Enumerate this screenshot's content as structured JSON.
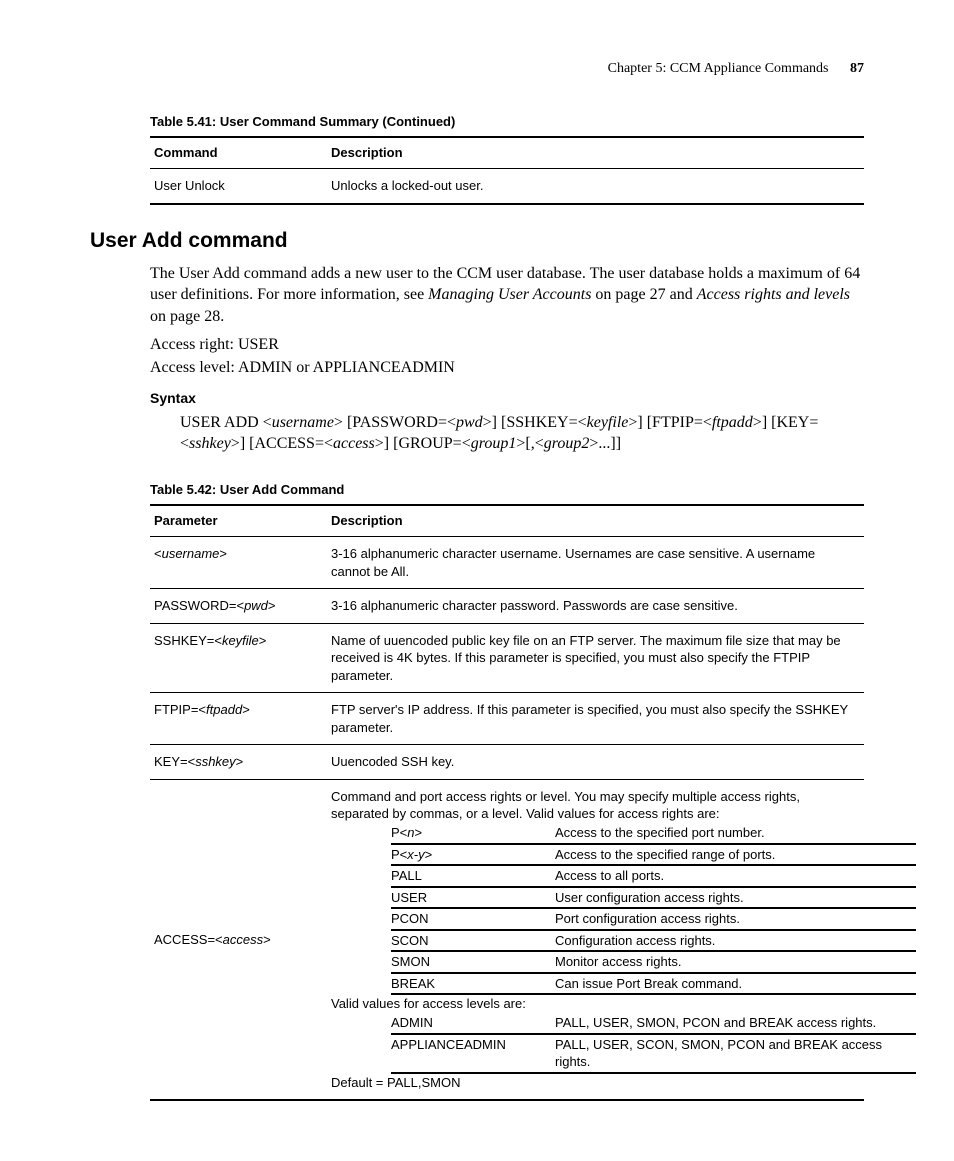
{
  "header": {
    "chapter": "Chapter 5: CCM Appliance Commands",
    "page": "87"
  },
  "table41": {
    "caption": "Table 5.41: User Command Summary (Continued)",
    "head": {
      "c1": "Command",
      "c2": "Description"
    },
    "rows": [
      {
        "c1": "User Unlock",
        "c2": "Unlocks a locked-out user."
      }
    ]
  },
  "section": {
    "heading": "User Add command",
    "p1a": "The User Add command adds a new user to the CCM user database. The user database holds a maximum of 64 user definitions. For more information, see ",
    "p1b": "Managing User Accounts",
    "p1c": " on page 27 and ",
    "p1d": "Access rights and levels",
    "p1e": " on page 28.",
    "access_right": "Access right: USER",
    "access_level": "Access level: ADMIN or APPLIANCEADMIN",
    "syntax_label": "Syntax",
    "syntax": {
      "s1": "USER ADD <",
      "s1i": "username",
      "s2": "> [PASSWORD=<",
      "s2i": "pwd",
      "s3": ">] [SSHKEY=<",
      "s3i": "keyfile",
      "s4": ">] [FTPIP=<",
      "s4i": "ftpadd",
      "s5": ">] [KEY=<",
      "s5i": "sshkey",
      "s6": ">] [ACCESS=<",
      "s6i": "access",
      "s7": ">] [GROUP=<",
      "s7i": "group1",
      "s8": ">[,<",
      "s8i": "group2",
      "s9": ">...]]"
    }
  },
  "table42": {
    "caption": "Table 5.42: User Add Command",
    "head": {
      "c1": "Parameter",
      "c2": "Description"
    },
    "rows": {
      "r0": {
        "p1": "<",
        "p1i": "username",
        "p2": ">",
        "d": "3-16 alphanumeric character username. Usernames are case sensitive. A username cannot be All."
      },
      "r1": {
        "p1": "PASSWORD=<",
        "p1i": "pwd",
        "p2": ">",
        "d": "3-16 alphanumeric character password. Passwords are case sensitive."
      },
      "r2": {
        "p1": "SSHKEY=<",
        "p1i": "keyfile",
        "p2": ">",
        "d": "Name of uuencoded public key file on an FTP server. The maximum file size that may be received is 4K bytes. If this parameter is specified, you must also specify the FTPIP parameter."
      },
      "r3": {
        "p1": "FTPIP=<",
        "p1i": "ftpadd",
        "p2": ">",
        "d": "FTP server's IP address. If this parameter is specified, you must also specify the SSHKEY parameter."
      },
      "r4": {
        "p1": "KEY=<",
        "p1i": "sshkey",
        "p2": ">",
        "d": "Uuencoded SSH key."
      },
      "r5": {
        "p1": "ACCESS=<",
        "p1i": "access",
        "p2": ">",
        "intro": "Command and port access rights or level. You may specify multiple access rights, separated by commas, or a level. Valid values for access rights are:",
        "items": [
          {
            "k1": "P<",
            "ki": "n",
            "k2": ">",
            "v": "Access to the specified port number."
          },
          {
            "k1": "P<",
            "ki": "x-y",
            "k2": ">",
            "v": "Access to the specified range of ports."
          },
          {
            "k1": "PALL",
            "v": "Access to all ports."
          },
          {
            "k1": "USER",
            "v": "User configuration access rights."
          },
          {
            "k1": "PCON",
            "v": "Port configuration access rights."
          },
          {
            "k1": "SCON",
            "v": "Configuration access rights."
          },
          {
            "k1": "SMON",
            "v": "Monitor access rights."
          },
          {
            "k1": "BREAK",
            "v": "Can issue Port Break command."
          }
        ],
        "levels_intro": "Valid values for access levels are:",
        "levels": [
          {
            "k": "ADMIN",
            "v": "PALL, USER, SMON, PCON and BREAK access rights."
          },
          {
            "k": "APPLIANCEADMIN",
            "v": "PALL, USER, SCON, SMON, PCON and BREAK access rights."
          }
        ],
        "default": "Default = PALL,SMON"
      }
    }
  }
}
